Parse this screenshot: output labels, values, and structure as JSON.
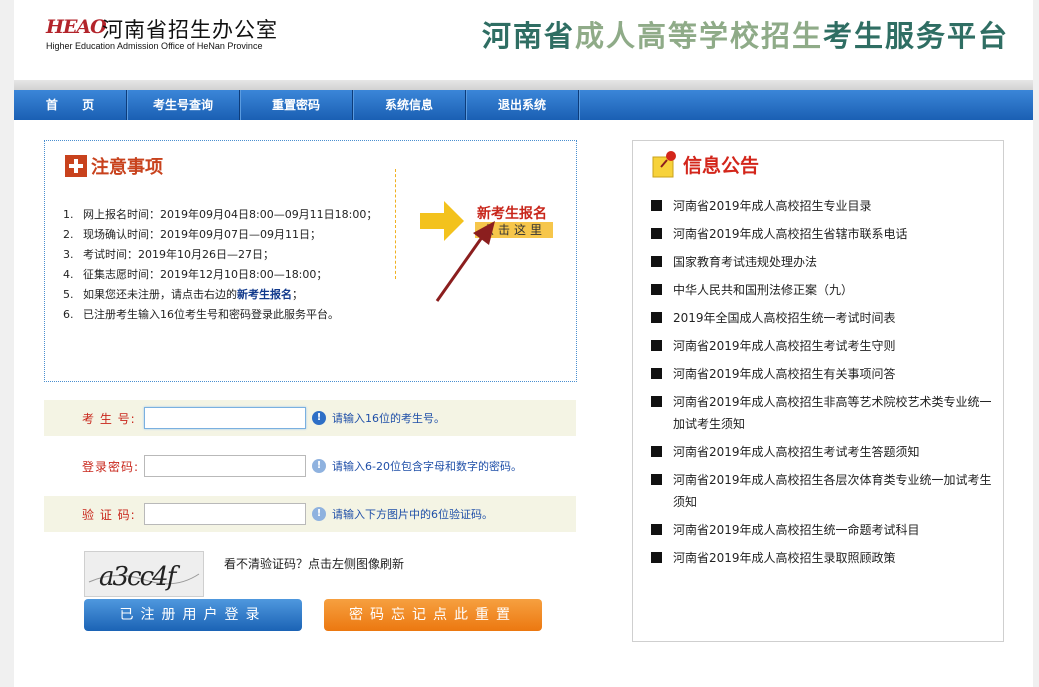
{
  "header": {
    "logo_mark": "HEAO",
    "logo_cn": "河南省招生办公室",
    "logo_en": "Higher Education Admission Office of HeNan Province",
    "site_title_a": "河南省",
    "site_title_b": "成人高等学校招生",
    "site_title_c": "考生服务平台"
  },
  "nav": {
    "items": [
      "首 页",
      "考生号查询",
      "重置密码",
      "系统信息",
      "退出系统"
    ]
  },
  "notice": {
    "title": "注意事项",
    "items": [
      {
        "num": "1.",
        "text": "网上报名时间：2019年09月04日8:00—09月11日18:00；"
      },
      {
        "num": "2.",
        "text": "现场确认时间：2019年09月07日—09月11日；"
      },
      {
        "num": "3.",
        "text": "考试时间：2019年10月26日—27日；"
      },
      {
        "num": "4.",
        "text": "征集志愿时间：2019年12月10日8:00—18:00；"
      },
      {
        "num": "5.",
        "text_before": "如果您还未注册，请点击右边的",
        "highlight": "新考生报名",
        "text_after": "；"
      },
      {
        "num": "6.",
        "text": "已注册考生输入16位考生号和密码登录此服务平台。"
      }
    ],
    "signup_label": "新考生报名",
    "signup_click": "点击这里"
  },
  "login": {
    "examinee_label": "考 生 号:",
    "examinee_value": "",
    "examinee_hint": "请输入16位的考生号。",
    "password_label": "登录密码:",
    "password_value": "",
    "password_hint": "请输入6-20位包含字母和数字的密码。",
    "captcha_label": "验 证 码:",
    "captcha_value": "",
    "captcha_hint": "请输入下方图片中的6位验证码。",
    "captcha_text": "a3cc4f",
    "captcha_tip": "看不清验证码？点击左侧图像刷新",
    "login_button": "已注册用户登录",
    "reset_button": "密码忘记点此重置"
  },
  "announcements": {
    "title": "信息公告",
    "items": [
      "河南省2019年成人高校招生专业目录",
      "河南省2019年成人高校招生省辖市联系电话",
      "国家教育考试违规处理办法",
      "中华人民共和国刑法修正案（九）",
      "2019年全国成人高校招生统一考试时间表",
      "河南省2019年成人高校招生考试考生守则",
      "河南省2019年成人高校招生有关事项问答",
      "河南省2019年成人高校招生非高等艺术院校艺术类专业统一加试考生须知",
      "河南省2019年成人高校招生考试考生答题须知",
      "河南省2019年成人高校招生各层次体育类专业统一加试考生须知",
      "河南省2019年成人高校招生统一命题考试科目",
      "河南省2019年成人高校招生录取照顾政策"
    ]
  },
  "colors": {
    "nav_blue": "#1a5fb3",
    "title_green": "#2f6e63",
    "accent_red": "#c8261b",
    "button_orange": "#ec7810"
  }
}
